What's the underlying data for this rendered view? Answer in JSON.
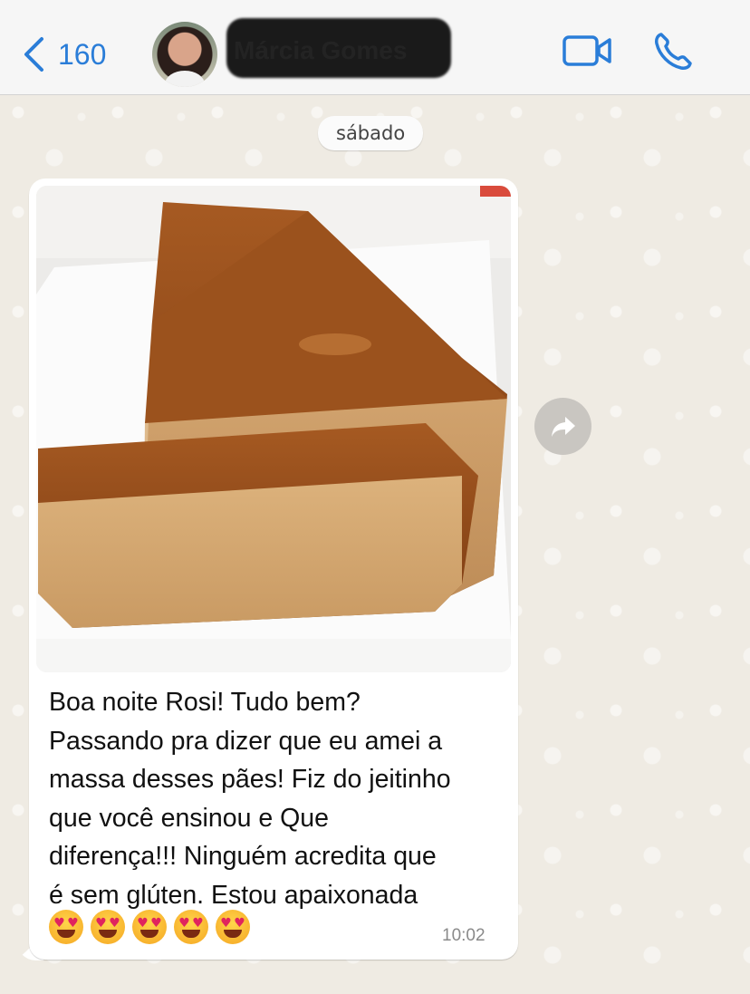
{
  "header": {
    "back_count": "160",
    "contact_name": "Márcia Gomes",
    "icons": {
      "back": "chevron-left-icon",
      "video": "video-camera-icon",
      "call": "phone-icon"
    },
    "accent": "#2a7dd8"
  },
  "chat": {
    "date_label": "sábado",
    "message": {
      "image": "photo of sliced loaf cake on white plate",
      "text": "Boa noite Rosi! Tudo bem?\nPassando pra dizer que eu amei a\nmassa desses pães! Fiz do jeitinho\nque você ensinou e Que\ndiferença!!! Ninguém acredita que\né sem glúten. Estou apaixonada",
      "emojis": [
        "😍",
        "😍",
        "😍",
        "😍",
        "😍"
      ],
      "time": "10:02"
    },
    "forward_icon": "forward-arrow-icon"
  }
}
